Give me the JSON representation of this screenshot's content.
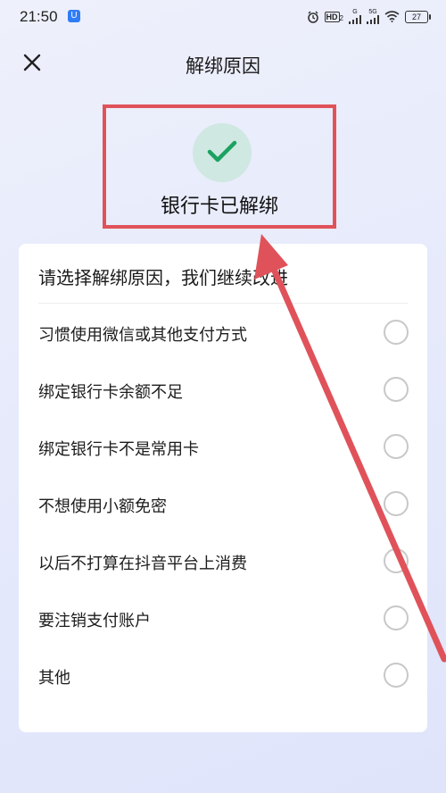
{
  "status_bar": {
    "time": "21:50",
    "app_badge": "U",
    "hd": "HD",
    "hd_sub": "2",
    "net1": "G",
    "net2": "5G",
    "battery": "27"
  },
  "nav": {
    "title": "解绑原因"
  },
  "result": {
    "text": "银行卡已解绑"
  },
  "card": {
    "header": "请选择解绑原因，我们继续改进",
    "reasons": [
      {
        "label": "习惯使用微信或其他支付方式"
      },
      {
        "label": "绑定银行卡余额不足"
      },
      {
        "label": "绑定银行卡不是常用卡"
      },
      {
        "label": "不想使用小额免密"
      },
      {
        "label": "以后不打算在抖音平台上消费"
      },
      {
        "label": "要注销支付账户"
      },
      {
        "label": "其他"
      }
    ]
  },
  "colors": {
    "annotation": "#e0525a",
    "check": "#1aa260",
    "check_bg": "#cfe8e2"
  }
}
